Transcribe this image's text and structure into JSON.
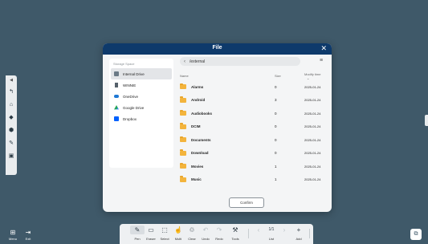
{
  "dialog": {
    "title": "File",
    "storage_label": "Storage Space",
    "storage_items": [
      {
        "label": "Internal Drive",
        "icon": "drive-icon",
        "color": "#6b7a86"
      },
      {
        "label": "WINNIE",
        "icon": "usb-icon",
        "color": "#55616b"
      },
      {
        "label": "OneDrive",
        "icon": "onedrive-icon",
        "color": "#1e78d4"
      },
      {
        "label": "Google Drive",
        "icon": "google-drive-icon",
        "color": "#1fa463"
      },
      {
        "label": "Dropbox",
        "icon": "dropbox-icon",
        "color": "#0061fe"
      }
    ],
    "path": "/external",
    "columns": {
      "name": "Name",
      "size": "Size",
      "modified": "Modify time"
    },
    "files": [
      {
        "name": "Alarms",
        "size": "0",
        "modified": "2025-01-24"
      },
      {
        "name": "Android",
        "size": "3",
        "modified": "2025-01-24"
      },
      {
        "name": "Audiobooks",
        "size": "0",
        "modified": "2025-01-24"
      },
      {
        "name": "DCIM",
        "size": "0",
        "modified": "2025-01-24"
      },
      {
        "name": "Documents",
        "size": "0",
        "modified": "2025-01-24"
      },
      {
        "name": "Download",
        "size": "0",
        "modified": "2025-01-24"
      },
      {
        "name": "Movies",
        "size": "1",
        "modified": "2025-01-24"
      },
      {
        "name": "Music",
        "size": "1",
        "modified": "2025-01-24"
      }
    ],
    "confirm_label": "Confirm"
  },
  "bottom_left": {
    "menu_label": "Menu",
    "exit_label": "Exit"
  },
  "toolbar": {
    "tools": [
      {
        "label": "Pen",
        "icon": "pen-icon",
        "glyph": "✎"
      },
      {
        "label": "Eraser",
        "icon": "eraser-icon",
        "glyph": "▭"
      },
      {
        "label": "Select",
        "icon": "select-icon",
        "glyph": "⬚"
      },
      {
        "label": "Multi",
        "icon": "multi-touch-icon",
        "glyph": "☝"
      },
      {
        "label": "Clear",
        "icon": "clear-icon",
        "glyph": "♲"
      },
      {
        "label": "Undo",
        "icon": "undo-icon",
        "glyph": "↶"
      },
      {
        "label": "Redo",
        "icon": "redo-icon",
        "glyph": "↷"
      },
      {
        "label": "Tools",
        "icon": "toolbox-icon",
        "glyph": "⚒"
      }
    ],
    "page_indicator": "1/1",
    "list_label": "List",
    "add_label": "Add"
  }
}
